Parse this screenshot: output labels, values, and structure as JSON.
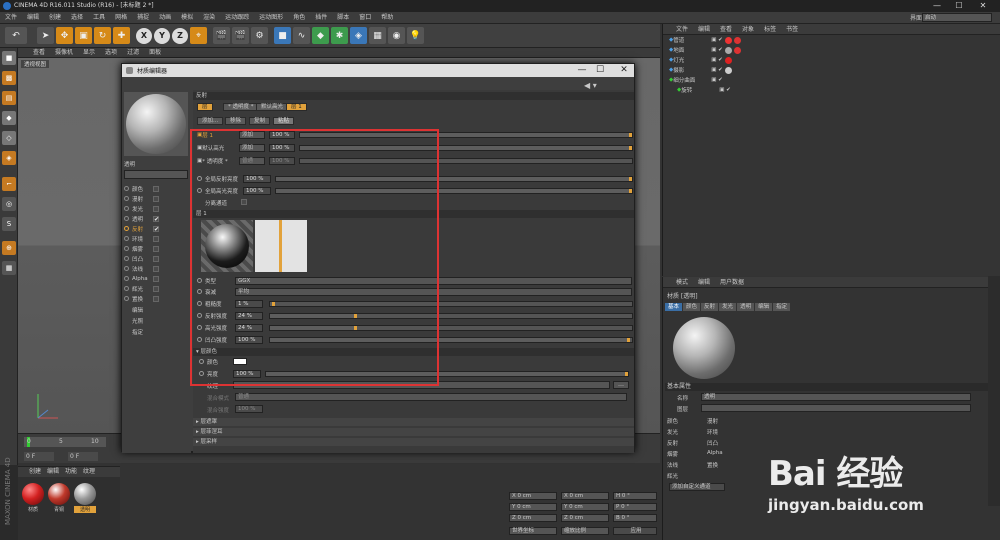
{
  "titlebar": {
    "title": "CINEMA 4D R16.011 Studio (R16) - [未标题 2 *]",
    "minimize": "—",
    "maximize": "☐",
    "close": "✕"
  },
  "menubar": {
    "items": [
      "文件",
      "编辑",
      "创建",
      "选择",
      "工具",
      "网格",
      "捕捉",
      "动画",
      "模拟",
      "渲染",
      "运动跟踪",
      "运动图形",
      "角色",
      "插件",
      "脚本",
      "窗口",
      "帮助"
    ],
    "layout_label": "界面:",
    "layout_value": "启动"
  },
  "toolbar": {
    "axes": [
      "X",
      "Y",
      "Z"
    ]
  },
  "viewport": {
    "menu": [
      "查看",
      "摄像机",
      "显示",
      "选项",
      "过滤",
      "面板"
    ],
    "label": "透视视图"
  },
  "timeline": {
    "ticks": [
      "0",
      "5",
      "10"
    ],
    "start": "0 F",
    "current": "0 F"
  },
  "material_manager": {
    "menu": [
      "创建",
      "编辑",
      "功能",
      "纹理"
    ],
    "materials": [
      {
        "name": "材质",
        "color": "#d22020"
      },
      {
        "name": "青铜",
        "color": "#c0392b"
      },
      {
        "name": "透明",
        "color": "#aaaaaa"
      }
    ]
  },
  "coords": {
    "x1": "X  0 cm",
    "y1": "Y  0 cm",
    "z1": "Z  0 cm",
    "x2": "X  0 cm",
    "y2": "Y  0 cm",
    "z2": "Z  0 cm",
    "h": "H  0 °",
    "p": "P  0 °",
    "b": "B  0 °",
    "mode1": "世界坐标",
    "mode2": "缩放比例",
    "apply": "应用"
  },
  "object_manager": {
    "menu": [
      "文件",
      "编辑",
      "查看",
      "对象",
      "标签",
      "书签"
    ],
    "objects": [
      "管道",
      "地面",
      "灯光",
      "摄影",
      "细分曲面",
      "旋转"
    ]
  },
  "attribute_manager": {
    "menu": [
      "模式",
      "编辑",
      "用户数据"
    ],
    "title": "材质 [透明]",
    "tabs": [
      "基本",
      "颜色",
      "反射",
      "发光",
      "透明",
      "编辑",
      "指定"
    ],
    "section": "基本属性",
    "name_label": "名称",
    "name_value": "透明",
    "layer_label": "图层",
    "channels_left": [
      "颜色",
      "发光",
      "反射",
      "烟雾",
      "法线",
      "辉光"
    ],
    "channels_right": [
      "漫射",
      "环境",
      "凹凸",
      "Alpha",
      "置换"
    ],
    "add_button": "添加自定义通道"
  },
  "watermark": {
    "brand": "Bai 经验",
    "url": "jingyan.baidu.com"
  },
  "maxon": "MAXON CINEMA 4D",
  "material_editor": {
    "title": "材质编辑器",
    "mat_name": "透明",
    "channels": [
      {
        "name": "颜色",
        "checked": false
      },
      {
        "name": "漫射",
        "checked": false
      },
      {
        "name": "发光",
        "checked": false
      },
      {
        "name": "透明",
        "checked": true
      },
      {
        "name": "反射",
        "checked": true
      },
      {
        "name": "环境",
        "checked": false
      },
      {
        "name": "烟雾",
        "checked": false
      },
      {
        "name": "凹凸",
        "checked": false
      },
      {
        "name": "法线",
        "checked": false
      },
      {
        "name": "Alpha",
        "checked": false
      },
      {
        "name": "辉光",
        "checked": false
      },
      {
        "name": "置换",
        "checked": false
      }
    ],
    "sublinks": [
      "编辑",
      "光照",
      "指定"
    ],
    "section_reflect": "反射",
    "layer_tabs": {
      "layers": "层",
      "transparent": "* 透明度 *",
      "default_spec": "默认高光",
      "layer1": "层 1"
    },
    "layer_btns": [
      "添加...",
      "移除",
      "复制",
      "粘贴"
    ],
    "layer_rows": [
      {
        "name": "层 1",
        "mode": "添加",
        "value": "100 %"
      },
      {
        "name": "默认高光",
        "mode": "添加",
        "value": "100 %"
      },
      {
        "name": "* 透明度 *",
        "mode": "普通",
        "value": "100 %"
      }
    ],
    "global_refl": {
      "label": "全局反射亮度",
      "value": "100 %"
    },
    "global_spec": {
      "label": "全局高光亮度",
      "value": "100 %"
    },
    "separate": "分离通道",
    "layer_section": "层 1",
    "type_label": "类型",
    "type_value": "GGX",
    "atten_label": "衰减",
    "atten_value": "平均",
    "params": [
      {
        "label": "粗糙度",
        "value": "1 %",
        "fraction": 0.01
      },
      {
        "label": "反射强度",
        "value": "24 %",
        "fraction": 0.24
      },
      {
        "label": "高光强度",
        "value": "24 %",
        "fraction": 0.24
      },
      {
        "label": "凹凸强度",
        "value": "100 %",
        "fraction": 1.0
      }
    ],
    "layer_color_section": "层颜色",
    "color_label": "颜色",
    "brightness_label": "亮度",
    "brightness_value": "100 %",
    "texture_label": "纹理",
    "blend_mode_label": "混合模式",
    "blend_mode_value": "普通",
    "blend_strength_label": "混合强度",
    "blend_strength_value": "100 %",
    "collapsed": [
      "层遮罩",
      "层菲涅耳",
      "层采样"
    ]
  }
}
